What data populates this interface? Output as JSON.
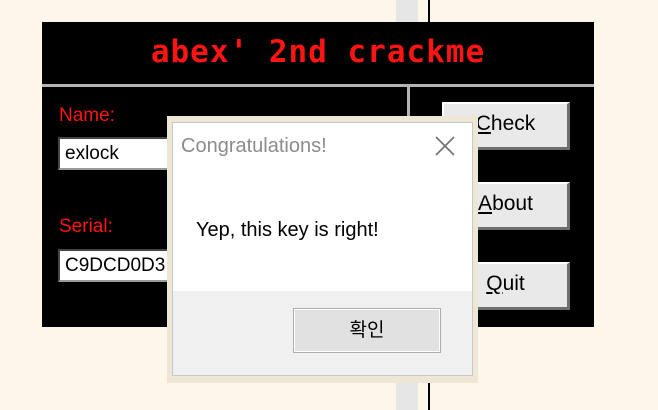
{
  "crackme": {
    "title": "abex' 2nd crackme",
    "name_label": "Name:",
    "name_value": "exlock",
    "serial_label": "Serial:",
    "serial_value": "C9DCD0D3",
    "check_button": {
      "mnemonic": "C",
      "rest": "heck"
    },
    "about_button": {
      "mnemonic": "A",
      "rest": "bout"
    },
    "quit_button": {
      "mnemonic": "Q",
      "rest": "uit"
    },
    "colors": {
      "background": "#000000",
      "accent": "#ff1414"
    }
  },
  "dialog": {
    "title": "Congratulations!",
    "message": "Yep, this key is right!",
    "ok_label": "확인",
    "close_icon": "close-icon"
  }
}
